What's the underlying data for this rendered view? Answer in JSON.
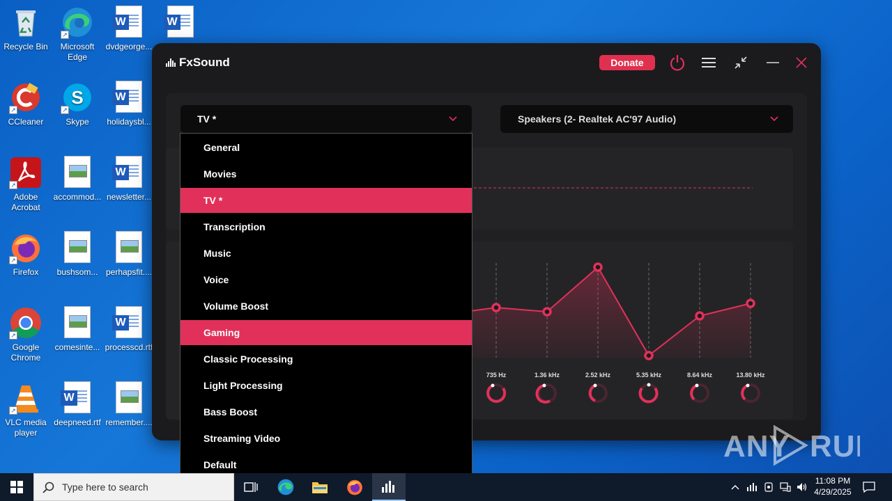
{
  "desktop": {
    "icons": [
      {
        "label": "Recycle Bin",
        "icon": "recycle-bin-icon"
      },
      {
        "label": "Microsoft Edge",
        "icon": "edge-icon"
      },
      {
        "label": "dvdgeorge...",
        "icon": "word-doc-icon"
      },
      {
        "label": "",
        "icon": "word-doc-icon"
      },
      {
        "label": "CCleaner",
        "icon": "ccleaner-icon"
      },
      {
        "label": "Skype",
        "icon": "skype-icon"
      },
      {
        "label": "holidaysbl...",
        "icon": "word-doc-icon"
      },
      {
        "label": "Adobe Acrobat",
        "icon": "acrobat-icon"
      },
      {
        "label": "accommod...",
        "icon": "image-file-icon"
      },
      {
        "label": "newsletter...",
        "icon": "word-doc-icon"
      },
      {
        "label": "Firefox",
        "icon": "firefox-icon"
      },
      {
        "label": "bushsom...",
        "icon": "image-file-icon"
      },
      {
        "label": "perhapsfit....",
        "icon": "image-file-icon"
      },
      {
        "label": "Google Chrome",
        "icon": "chrome-icon"
      },
      {
        "label": "comesinte...",
        "icon": "image-file-icon"
      },
      {
        "label": "processcd.rtf",
        "icon": "word-doc-icon"
      },
      {
        "label": "VLC media player",
        "icon": "vlc-icon"
      },
      {
        "label": "deepneed.rtf",
        "icon": "word-doc-icon"
      },
      {
        "label": "remember....",
        "icon": "image-file-icon"
      }
    ]
  },
  "app": {
    "title": "FxSound",
    "donate_label": "Donate",
    "preset_selected": "TV *",
    "output_device": "Speakers (2- Realtek AC'97 Audio)",
    "accent_color": "#e1315a",
    "eq": {
      "bands": [
        "735 Hz",
        "1.36 kHz",
        "2.52 kHz",
        "5.35 kHz",
        "8.64 kHz",
        "13.80 kHz"
      ]
    },
    "preset_menu": [
      {
        "label": "General",
        "selected": false
      },
      {
        "label": "Movies",
        "selected": false
      },
      {
        "label": "TV *",
        "selected": true
      },
      {
        "label": "Transcription",
        "selected": false
      },
      {
        "label": "Music",
        "selected": false
      },
      {
        "label": "Voice",
        "selected": false
      },
      {
        "label": "Volume Boost",
        "selected": false
      },
      {
        "label": "Gaming",
        "selected": true
      },
      {
        "label": "Classic Processing",
        "selected": false
      },
      {
        "label": "Light Processing",
        "selected": false
      },
      {
        "label": "Bass Boost",
        "selected": false
      },
      {
        "label": "Streaming Video",
        "selected": false
      },
      {
        "label": "Default",
        "selected": false
      }
    ]
  },
  "watermark": "ANY RUN",
  "taskbar": {
    "search_placeholder": "Type here to search",
    "time": "11:08 PM",
    "date": "4/29/2025"
  }
}
